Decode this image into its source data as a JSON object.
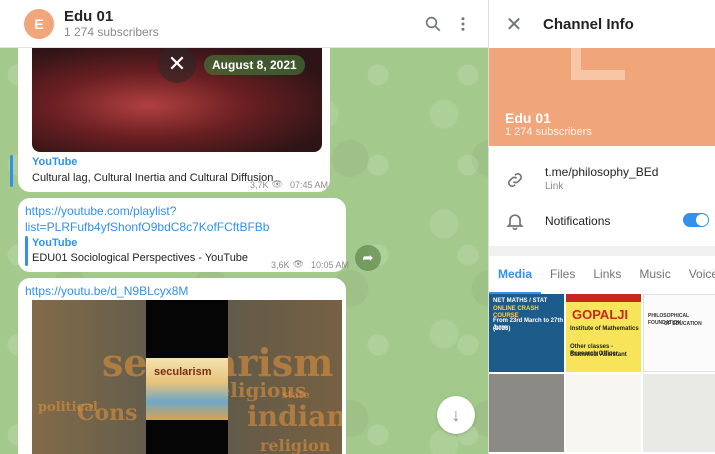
{
  "chat": {
    "avatar_letter": "E",
    "title": "Edu 01",
    "subscribers": "1 274 subscribers",
    "search_icon": "search-icon",
    "more_icon": "more-vertical-icon"
  },
  "messages": [
    {
      "date": "August 8, 2021",
      "site": "YouTube",
      "description": "Cultural lag, Cultural Inertia and Cultural Diffusion",
      "views": "3,7K",
      "time": "07:45 AM"
    },
    {
      "link": "https://youtube.com/playlist?list=PLRFufb4yfShonfO9bdC8c7KofFCftBFBb",
      "link_line1": "https://youtube.com/playlist?",
      "link_line2": "list=PLRFufb4yfShonfO9bdC8c7KofFCftBFBb",
      "site": "YouTube",
      "description": "EDU01 Sociological Perspectives - YouTube",
      "views": "3,6K",
      "time": "10:05 AM"
    },
    {
      "link": "https://youtu.be/d_N9BLcyx8M",
      "thumb_text": "secularism",
      "cloud_words": [
        "secularism",
        "religious",
        "indian",
        "political",
        "Cons",
        "religion",
        "state"
      ]
    }
  ],
  "info": {
    "title": "Channel Info",
    "name": "Edu 01",
    "subscribers": "1 274 subscribers",
    "link": "t.me/philosophy_BEd",
    "link_label": "Link",
    "notifications": "Notifications",
    "notifications_on": true,
    "tabs": [
      "Media",
      "Files",
      "Links",
      "Music",
      "Voice"
    ],
    "active_tab": "Media",
    "media": [
      {
        "lines": [
          "NET MATHS / STAT",
          "ONLINE CRASH COURSE",
          "From 23rd March to 27th June",
          "(2023)"
        ]
      },
      {
        "lines": [
          "GOPALJI",
          "Institute of Mathematics",
          "Other classes - Research Officer",
          "Statistical Assistant"
        ]
      },
      {
        "lines": [
          "PHILOSOPHICAL FOUNDATION",
          "OF EDUCATION"
        ]
      },
      {
        "lines": []
      },
      {
        "lines": []
      },
      {
        "lines": []
      }
    ]
  },
  "colors": {
    "accent": "#3390ec",
    "avatar": "#f0a57a",
    "chat_bg": "#a4c98c"
  }
}
